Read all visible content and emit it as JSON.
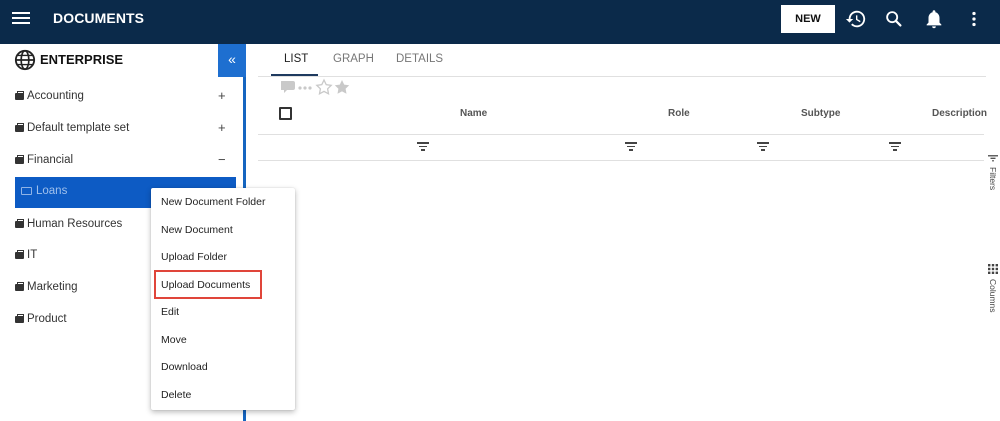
{
  "header": {
    "title": "DOCUMENTS",
    "new_label": "NEW",
    "icons": [
      "menu-icon",
      "history-icon",
      "search-icon",
      "bell-icon",
      "more-vertical-icon"
    ]
  },
  "sidebar": {
    "enterprise_title": "ENTERPRISE",
    "collapse_label": "«",
    "items": [
      {
        "label": "Accounting",
        "expander": "+"
      },
      {
        "label": "Default template set",
        "expander": "+"
      },
      {
        "label": "Financial",
        "expander": "−"
      },
      {
        "label": "Loans",
        "expander": ""
      },
      {
        "label": "Human Resources",
        "expander": ""
      },
      {
        "label": "IT",
        "expander": ""
      },
      {
        "label": "Marketing",
        "expander": ""
      },
      {
        "label": "Product",
        "expander": ""
      }
    ]
  },
  "tabs": [
    "LIST",
    "GRAPH",
    "DETAILS"
  ],
  "table": {
    "columns": [
      "Name",
      "Role",
      "Subtype",
      "Description"
    ]
  },
  "right_rail": {
    "filters_label": "Filters",
    "columns_label": "Columns"
  },
  "context_menu": {
    "items": [
      "New Document Folder",
      "New Document",
      "Upload Folder",
      "Upload Documents",
      "Edit",
      "Move",
      "Download",
      "Delete"
    ],
    "highlighted": "Upload Documents",
    "highlight_color": "#e0453a"
  },
  "colors": {
    "topbar": "#0b2a4a",
    "accent": "#1e6fd0",
    "selected": "#0d5bc4"
  }
}
